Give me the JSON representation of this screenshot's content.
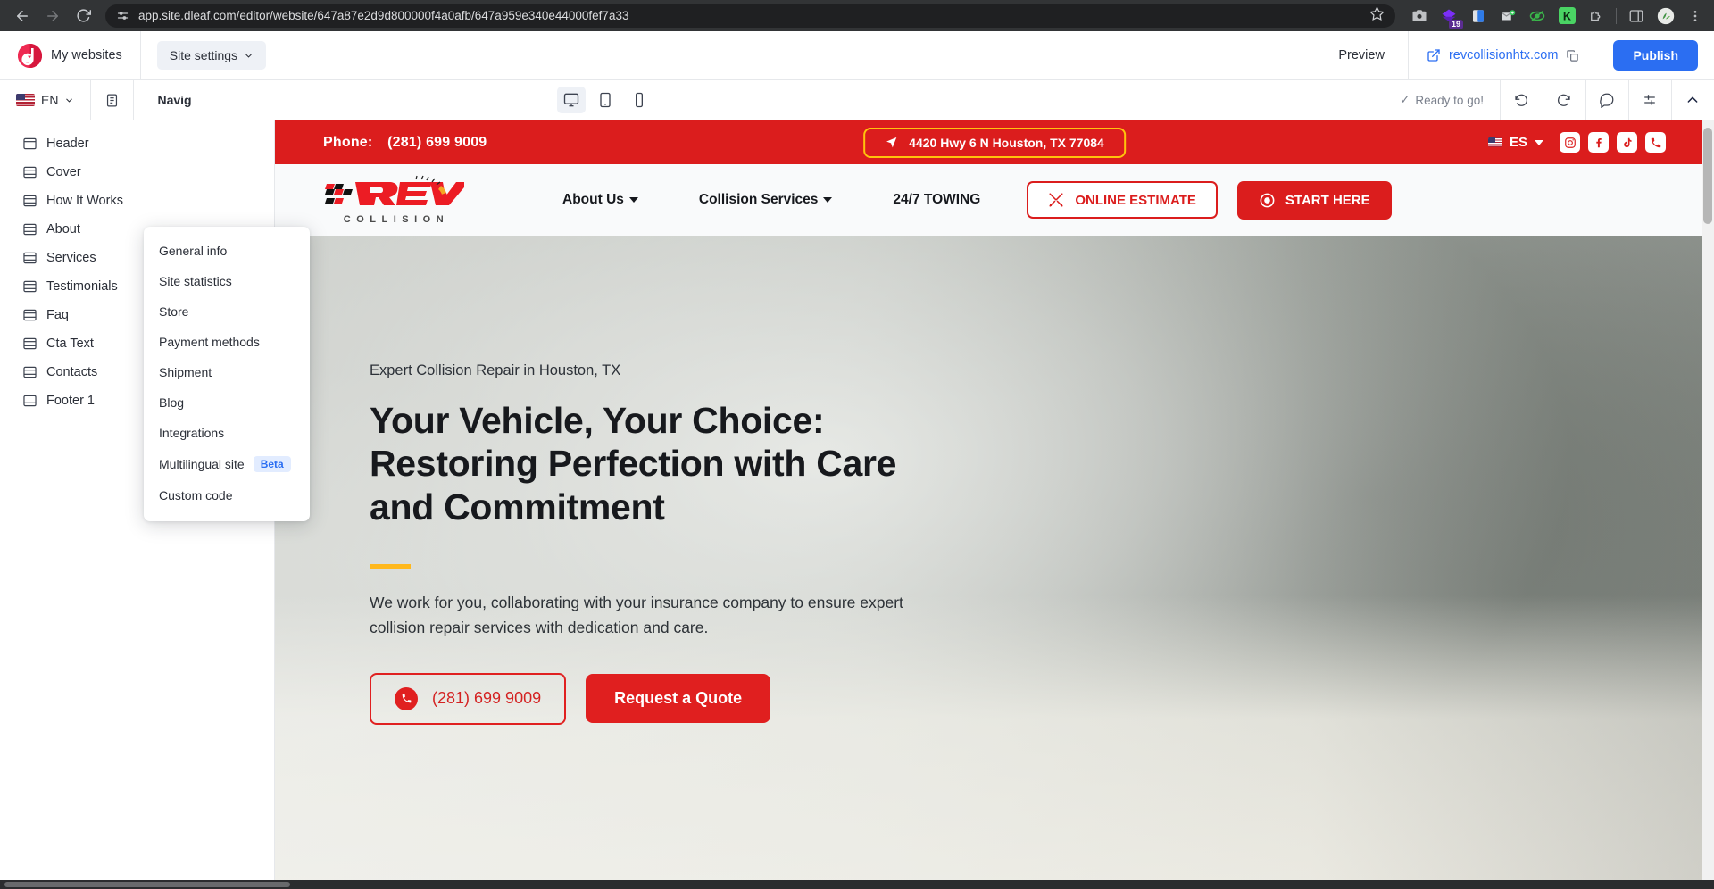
{
  "browser": {
    "url": "app.site.dleaf.com/editor/website/647a87e2d9d800000f4a0afb/647a959e340e44000fef7a33",
    "back_label": "Back",
    "forward_label": "Forward",
    "reload_label": "Reload",
    "site_info_label": "View site information",
    "bookmark_label": "Bookmark this tab",
    "extension_badge": "19",
    "menu_label": "Customize and control Chrome"
  },
  "topbar": {
    "my_websites": "My websites",
    "site_settings": "Site settings",
    "preview": "Preview",
    "domain": "revcollisionhtx.com",
    "publish": "Publish"
  },
  "site_settings_menu": {
    "items": [
      {
        "label": "General info"
      },
      {
        "label": "Site statistics"
      },
      {
        "label": "Store"
      },
      {
        "label": "Payment methods"
      },
      {
        "label": "Shipment"
      },
      {
        "label": "Blog"
      },
      {
        "label": "Integrations"
      },
      {
        "label": "Multilingual site",
        "badge": "Beta"
      },
      {
        "label": "Custom code"
      }
    ]
  },
  "secondbar": {
    "language": "EN",
    "nav_title": "Navig",
    "nav_title_full": "Navigator",
    "status": "Ready to go!",
    "status_check": "✓",
    "devices": [
      {
        "name": "desktop",
        "active": true
      },
      {
        "name": "tablet",
        "active": false
      },
      {
        "name": "mobile",
        "active": false
      }
    ]
  },
  "sidebar": {
    "items": [
      {
        "label": "Header",
        "icon": "header-block-icon"
      },
      {
        "label": "Cover",
        "icon": "block-icon"
      },
      {
        "label": "How It Works",
        "icon": "block-icon"
      },
      {
        "label": "About",
        "icon": "block-icon"
      },
      {
        "label": "Services",
        "icon": "block-icon"
      },
      {
        "label": "Testimonials",
        "icon": "block-icon"
      },
      {
        "label": "Faq",
        "icon": "block-icon"
      },
      {
        "label": "Cta Text",
        "icon": "block-icon"
      },
      {
        "label": "Contacts",
        "icon": "block-icon"
      },
      {
        "label": "Footer 1",
        "icon": "footer-block-icon"
      }
    ]
  },
  "site": {
    "topbar": {
      "phone_label": "Phone:",
      "phone_number": "(281) 699 9009",
      "address": "4420 Hwy 6 N Houston, TX 77084",
      "language": "ES",
      "socials": [
        "instagram",
        "facebook",
        "tiktok",
        "phone"
      ]
    },
    "nav": {
      "brand_main": "REV",
      "brand_sub": "COLLISION",
      "links": [
        {
          "label": "About Us",
          "has_caret": true
        },
        {
          "label": "Collision Services",
          "has_caret": true
        },
        {
          "label": "24/7 TOWING",
          "has_caret": false
        }
      ],
      "estimate_button": "ONLINE ESTIMATE",
      "start_button": "START HERE"
    },
    "hero": {
      "eyebrow": "Expert Collision Repair in Houston, TX",
      "heading_line1": "Your Vehicle, Your Choice:",
      "heading_line2": "Restoring Perfection with Care",
      "heading_line3": "and Commitment",
      "paragraph": "We work for you, collaborating with your insurance company to ensure expert collision repair services with dedication and care.",
      "phone_button": "(281) 699 9009",
      "quote_button": "Request a Quote"
    }
  },
  "colors": {
    "brand_red": "#db1d1d",
    "accent_yellow": "#ffc40c",
    "publish_blue": "#2b6ef2",
    "link_blue": "#2b6ef2"
  }
}
